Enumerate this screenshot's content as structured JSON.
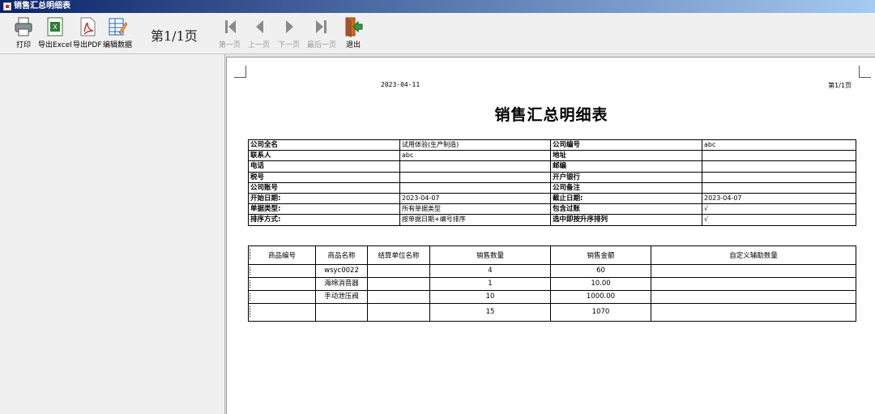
{
  "window": {
    "title": "销售汇总明细表"
  },
  "toolbar": {
    "print": "打印",
    "export_excel": "导出Excel",
    "export_pdf": "导出PDF",
    "edit_data": "编辑数据",
    "page_indicator": "第1/1页",
    "first_page": "第一页",
    "prev_page": "上一页",
    "next_page": "下一页",
    "last_page": "最后一页",
    "exit": "退出"
  },
  "report": {
    "date": "2023-04-11",
    "page": "第1/1页",
    "title": "销售汇总明细表",
    "info_rows": [
      [
        "公司全名",
        "试用体验(生产制造)",
        "公司编号",
        "abc"
      ],
      [
        "联系人",
        "abc",
        "地址",
        ""
      ],
      [
        "电话",
        "",
        "邮编",
        ""
      ],
      [
        "税号",
        "",
        "开户银行",
        ""
      ],
      [
        "公司账号",
        "",
        "公司备注",
        ""
      ],
      [
        "开始日期:",
        "2023-04-07",
        "截止日期:",
        "2023-04-07"
      ],
      [
        "单据类型:",
        "所有单据类型",
        "包含过账",
        "√"
      ],
      [
        "排序方式:",
        "按单据日期+编号排序",
        "选中即按升序排列",
        "√"
      ]
    ],
    "detail_headers": [
      "商品编号",
      "商品名称",
      "结算单位名称",
      "销售数量",
      "销售金额",
      "自定义辅助数量"
    ],
    "detail_rows": [
      [
        "",
        "wsyc0022",
        "",
        "4",
        "60",
        ""
      ],
      [
        "",
        "海绵消音器",
        "",
        "1",
        "10.00",
        ""
      ],
      [
        "",
        "手动泄压阀",
        "",
        "10",
        "1000.00",
        ""
      ]
    ],
    "totals": [
      "",
      "",
      "",
      "15",
      "1070",
      ""
    ]
  }
}
